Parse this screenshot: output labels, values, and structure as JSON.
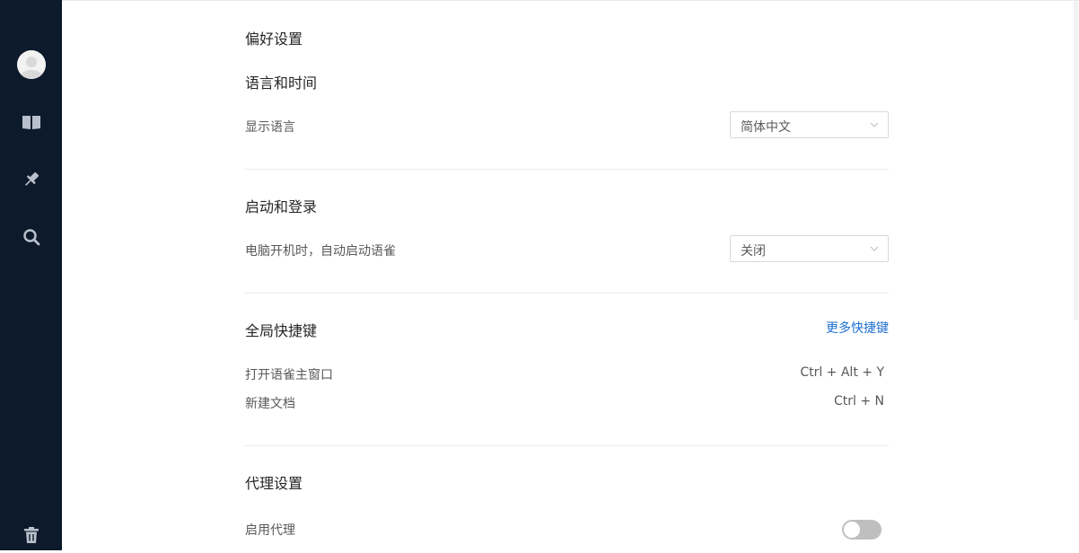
{
  "sidebar": {
    "items": [
      {
        "icon": "avatar"
      },
      {
        "icon": "book-icon"
      },
      {
        "icon": "pin-icon"
      },
      {
        "icon": "search-icon"
      },
      {
        "icon": "trash-icon"
      }
    ],
    "background": "#0d1a2b"
  },
  "page": {
    "title": "偏好设置"
  },
  "language_section": {
    "title": "语言和时间",
    "display_language_label": "显示语言",
    "display_language_value": "简体中文"
  },
  "startup_section": {
    "title": "启动和登录",
    "auto_start_label": "电脑开机时，自动启动语雀",
    "auto_start_value": "关闭"
  },
  "shortcuts_section": {
    "title": "全局快捷键",
    "more_link": "更多快捷键",
    "shortcuts": [
      {
        "label": "打开语雀主窗口",
        "keys": "Ctrl + Alt + Y"
      },
      {
        "label": "新建文档",
        "keys": "Ctrl + N"
      }
    ]
  },
  "proxy_section": {
    "title": "代理设置",
    "enable_proxy_label": "启用代理",
    "enable_proxy_on": false
  },
  "colors": {
    "link": "#1f6fd1",
    "toggle_off": "#bfbfbf"
  }
}
